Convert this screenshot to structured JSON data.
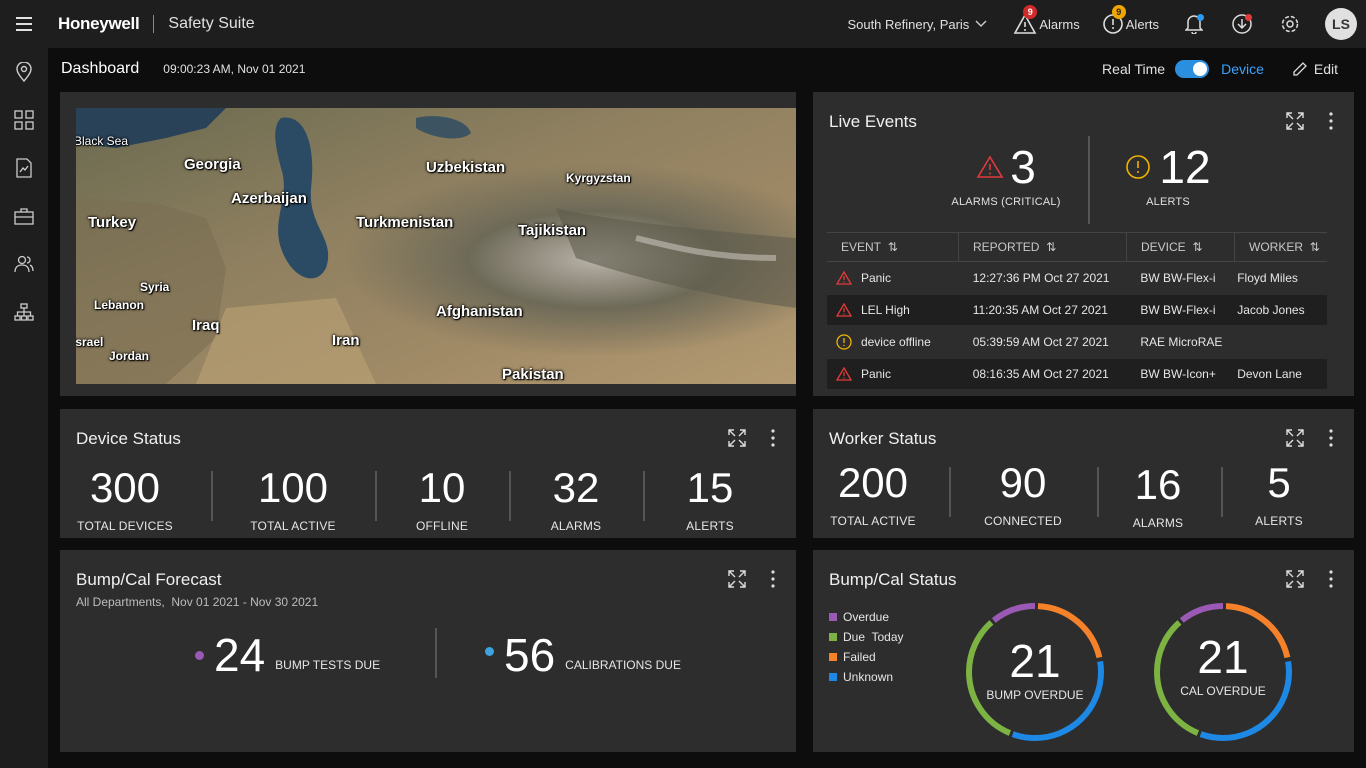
{
  "brand": {
    "logo": "Honeywell",
    "suite": "Safety Suite"
  },
  "topbar": {
    "site": "South Refinery, Paris",
    "alarms_label": "Alarms",
    "alarms_count": "9",
    "alerts_label": "Alerts",
    "alerts_count": "9",
    "avatar_initials": "LS"
  },
  "subheader": {
    "title": "Dashboard",
    "timestamp": "09:00:23 AM, Nov 01 2021",
    "realtime_label": "Real Time",
    "device_label": "Device",
    "edit_label": "Edit"
  },
  "map": {
    "labels": [
      "Black Sea",
      "Georgia",
      "Azerbaijan",
      "Turkey",
      "Uzbekistan",
      "Kyrgyzstan",
      "Turkmenistan",
      "Tajikistan",
      "Syria",
      "Lebanon",
      "Iraq",
      "Israel",
      "Jordan",
      "Iran",
      "Afghanistan",
      "Pakistan"
    ],
    "colors": {
      "land": "#8a7a5a",
      "water": "#2a4560",
      "mountain": "#6b6b55"
    }
  },
  "live_events": {
    "title": "Live Events",
    "alarms_count": "3",
    "alarms_label": "ALARMS (CRITICAL)",
    "alerts_count": "12",
    "alerts_label": "ALERTS",
    "columns": [
      "EVENT",
      "REPORTED",
      "DEVICE",
      "WORKER"
    ],
    "rows": [
      {
        "type": "alarm",
        "event": "Panic",
        "reported": "12:27:36 PM Oct 27 2021",
        "device": "BW BW-Flex-i",
        "worker": "Floyd Miles"
      },
      {
        "type": "alarm",
        "event": "LEL High",
        "reported": "11:20:35 AM Oct 27 2021",
        "device": "BW BW-Flex-i",
        "worker": "Jacob Jones"
      },
      {
        "type": "alert",
        "event": "device offline",
        "reported": "05:39:59 AM Oct 27 2021",
        "device": "RAE MicroRAE",
        "worker": ""
      },
      {
        "type": "alarm",
        "event": "Panic",
        "reported": "08:16:35 AM Oct 27 2021",
        "device": "BW BW-Icon+",
        "worker": "Devon Lane"
      }
    ]
  },
  "device_status": {
    "title": "Device Status",
    "stats": [
      {
        "value": "300",
        "label": "TOTAL DEVICES"
      },
      {
        "value": "100",
        "label": "TOTAL ACTIVE"
      },
      {
        "value": "10",
        "label": "OFFLINE"
      },
      {
        "value": "32",
        "label": "ALARMS"
      },
      {
        "value": "15",
        "label": "ALERTS"
      }
    ]
  },
  "worker_status": {
    "title": "Worker Status",
    "stats": [
      {
        "value": "200",
        "label": "TOTAL ACTIVE"
      },
      {
        "value": "90",
        "label": "CONNECTED"
      },
      {
        "value": "16",
        "label": "ALARMS"
      },
      {
        "value": "5",
        "label": "ALERTS"
      }
    ]
  },
  "forecast": {
    "title": "Bump/Cal Forecast",
    "subtitle": "All Departments,  Nov 01 2021 - Nov 30 2021",
    "bump_value": "24",
    "bump_label": "BUMP TESTS DUE",
    "cal_value": "56",
    "cal_label": "CALIBRATIONS DUE",
    "bump_color": "#9b59b6",
    "cal_color": "#3ba3e0"
  },
  "bumpcal_status": {
    "title": "Bump/Cal Status",
    "legend": [
      {
        "label": "Overdue",
        "color": "#9b59b6"
      },
      {
        "label": "Due  Today",
        "color": "#7cb342"
      },
      {
        "label": "Failed",
        "color": "#f5822a"
      },
      {
        "label": "Unknown",
        "color": "#1e88e5"
      }
    ],
    "bump_value": "21",
    "bump_label": "BUMP OVERDUE",
    "cal_value": "21",
    "cal_label": "CAL OVERDUE"
  },
  "colors": {
    "accent": "#2b8fe0",
    "alarm": "#e03b3b",
    "alert": "#f0b400",
    "card": "#2d2d2d"
  }
}
